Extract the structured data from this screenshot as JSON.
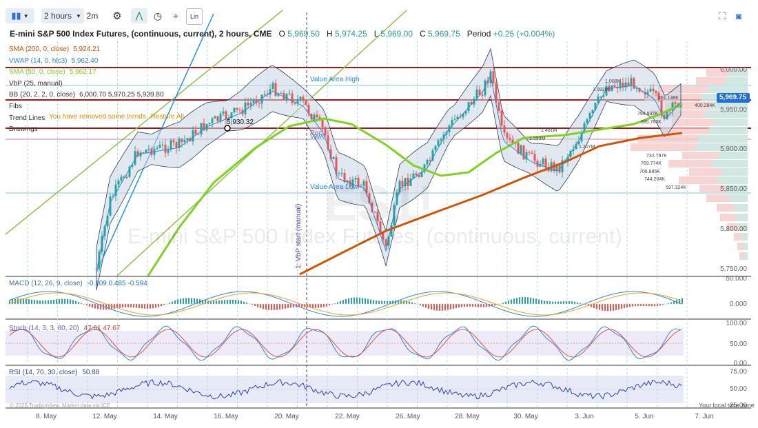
{
  "toolbar": {
    "interval": "2 hours",
    "interval2": "2m",
    "lin": "Lin"
  },
  "header": {
    "title": "E-mini S&P 500 Index Futures, (continuous, current), 2 hours, CME",
    "o_label": "O",
    "o": "5,969.50",
    "h_label": "H",
    "h": "5,974.25",
    "l_label": "L",
    "l": "5,969.00",
    "c_label": "C",
    "c": "5,969.75",
    "period_label": "Period",
    "period": "+0.25 (+0.004%)"
  },
  "overlays": [
    {
      "label": "SMA (200, 0, close)",
      "value": "5,924.21",
      "color": "#d35400"
    },
    {
      "label": "VWAP (14, 0, hlc3)",
      "value": "5,962.40",
      "color": "#2e86de"
    },
    {
      "label": "SMA (50, 0, close)",
      "value": "5,962.17",
      "color": "#7ed321"
    },
    {
      "label": "VbP (25, manual)",
      "value": "",
      "color": "#333333"
    },
    {
      "label": "BB (20, 2, 2, 0, close)",
      "value": "6,000.70  5,970.25  5,939.80",
      "color": "#333333"
    },
    {
      "label": "Fibs",
      "value": "",
      "color": "#333333"
    },
    {
      "label": "Trend Lines",
      "value": "",
      "color": "#333333"
    },
    {
      "label": "Drawings",
      "value": "",
      "color": "#333333"
    }
  ],
  "notice": {
    "text": "You have removed some trends",
    "action": "Restore All"
  },
  "watermark": {
    "symbol": "ES1!",
    "name": "E-mini S&P 500 Index Futures, (continuous, current)"
  },
  "annotations": {
    "value_area_high": "Value Area High",
    "value_area_low": "Value Area Low",
    "poc": "Poc",
    "vwap": "VWA",
    "marker": "5,930.32",
    "vbp_start": "1: VbP start (manual)"
  },
  "price_axis": {
    "ticks": [
      "6,000.00",
      "5,950.00",
      "5,900.00",
      "5,850.00",
      "5,800.00",
      "5,750.00"
    ],
    "last_price": "5,969.75"
  },
  "volume_profile": [
    "1.008M",
    "1.093M",
    "794.937K",
    "885.760K",
    "1.481M",
    "1.593M",
    "1.207M",
    "732.797K",
    "769.774K",
    "706.885K",
    "744.204K",
    "597.324K",
    "400.284K",
    "351.138K"
  ],
  "macd": {
    "label": "MACD (12, 26, 9, close)",
    "values": "-0.109  0.485  -0.594",
    "ticks": [
      "50.000",
      "0.000"
    ]
  },
  "stoch": {
    "label": "Stoch (14, 3, 3, 80, 20)",
    "values": "47.61  47.67",
    "ticks": [
      "100.00",
      "50.00",
      "0.00"
    ]
  },
  "rsi": {
    "label": "RSI (14, 70, 30, close)",
    "value": "50.88",
    "ticks": [
      "75.00",
      "50.00",
      "25.00"
    ]
  },
  "x_axis": [
    "8. May",
    "12. May",
    "14. May",
    "16. May",
    "20. May",
    "22. May",
    "26. May",
    "28. May",
    "30. May",
    "3. Jun",
    "5. Jun",
    "7. Jun"
  ],
  "footer": {
    "credit": "© 2025 TradingView. Market data via ICE",
    "tz": "Your local time zone"
  },
  "colors": {
    "up": "#26a69a",
    "down": "#ef5350",
    "sma200": "#d35400",
    "sma50": "#7ed321",
    "vwap": "#2e86de",
    "fib": "#a31515",
    "trend": "#8bc34a"
  }
}
